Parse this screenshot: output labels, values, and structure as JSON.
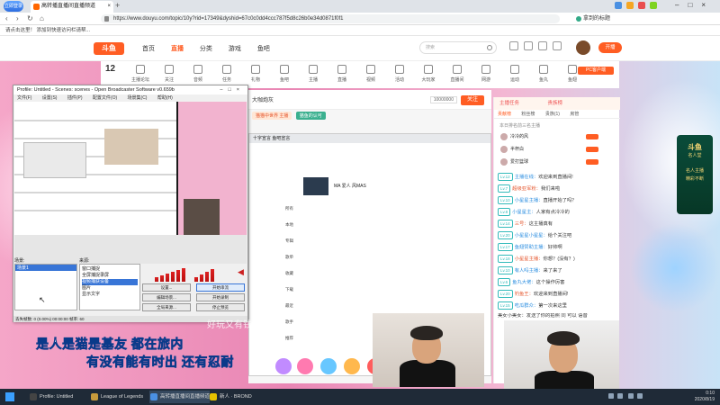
{
  "browser": {
    "badge": "立即登录",
    "tab_title": "高转播直播间直播频道",
    "url": "https://www.douyu.com/topic/10y?rid=17349&dyshid=67c0c0dd4ccc787f5d8c26b0e34d0871f0f1",
    "search_hint": "拿到的标题",
    "fav_text": "请点击这里！ 添加到快速访问栏请帮..."
  },
  "douyu": {
    "logo": "斗鱼",
    "nav": [
      "首页",
      "直播",
      "分类",
      "游戏",
      "鱼吧"
    ],
    "active_nav": "直播",
    "search_placeholder": "搜索",
    "kaibo": "开播",
    "follow_count": "12",
    "pc_btn": "PC客户端",
    "categories": [
      "主播论坛",
      "关注",
      "音频",
      "任务",
      "礼物",
      "鱼吧",
      "主播",
      "直播",
      "视频",
      "活动",
      "大玩家",
      "直播间",
      "网游",
      "运动",
      "鱼丸",
      "鱼翅",
      "更多"
    ]
  },
  "player": {
    "title": "大咖炮灰",
    "subtitle": "十字宣言 鱼吧宣言",
    "tags": [
      "猫猫中世界 主播",
      "猫鱼的认可"
    ],
    "view_count": "10000000",
    "follow": "关注",
    "cap_song": "MA 爱人 风MAS",
    "cap_rows": [
      "所有",
      "本地",
      "专辑",
      "歌单",
      "收藏",
      "下载",
      "最近",
      "歌手",
      "推荐"
    ]
  },
  "obs": {
    "title": "Profile: Untitled - Scenes: scenes - Open Broadcaster Software v0.659b",
    "menu": [
      "文件(F)",
      "设置(S)",
      "插件(P)",
      "配置文件(O)",
      "场景集(C)",
      "帮助(H)"
    ],
    "scenes_label": "场景:",
    "scene_selected": "场景1",
    "sources_label": "来源:",
    "sources": [
      "窗口捕捉",
      "全屏捕捉录屏",
      "视频捕获设备",
      "图片",
      "显示文字"
    ],
    "buttons": [
      "设置...",
      "开始串流",
      "编辑场景...",
      "开始录制",
      "全局来源...",
      "停止预览",
      "插件...",
      "退出"
    ],
    "status": "丢失帧数: 0 (0.00%)    00:00:00    帧率: 60"
  },
  "chat": {
    "head": "主播任务",
    "guard": "贵族榜",
    "tabs": [
      "贡献榜",
      "粉丝榜",
      "贵族(1)",
      "房管"
    ],
    "rank_title": "本日排名前三名主播",
    "ranks": [
      "冷冷的风",
      "半杯白",
      "爱打篮球"
    ],
    "messages": [
      {
        "lv": "Lv.12",
        "name": "主播在线：",
        "text": "欢迎来到直播间!"
      },
      {
        "lv": "Lv.7",
        "name": "超级亚军粉：",
        "text": "我们来啦"
      },
      {
        "lv": "Lv.10",
        "name": "小星星主播：",
        "text": "直播开始了吗？"
      },
      {
        "lv": "Lv.8",
        "name": "小星星主：",
        "text": "人家有点冷冷的"
      },
      {
        "lv": "Lv.14",
        "name": "三号：",
        "text": "这主播真有"
      },
      {
        "lv": "Lv.20",
        "name": "小星星小星星：",
        "text": "给个关注吧"
      },
      {
        "lv": "Lv.17",
        "name": "鱼翅赞助主播：",
        "text": "好帅啊"
      },
      {
        "lv": "Lv.18",
        "name": "小星星主播：",
        "text": "你想？(没有？)"
      },
      {
        "lv": "Lv.10",
        "name": "有人吗主播：",
        "text": "来了来了"
      },
      {
        "lv": "Lv.6",
        "name": "鱼丸大佬：",
        "text": "这个操作厉害"
      },
      {
        "lv": "Lv.20",
        "name": "钓鱼王：",
        "text": "欢迎来到直播间!"
      },
      {
        "lv": "Lv.15",
        "name": "吃瓜群众：",
        "text": "第一次来这里"
      }
    ],
    "footer_msg": "美女小美女：发送了你的拍照 同 可以 语音"
  },
  "overlay": {
    "line1": "是人是猫是基友 都在旅内",
    "line2": "有没有能有时出 还有忍耐",
    "ghost": "好玩又有钱吧"
  },
  "side_ad": {
    "title": "斗鱼",
    "line1": "名人堂",
    "line2": "名人主播",
    "line3": "精彩不断"
  },
  "taskbar": {
    "apps": [
      "Profile: Untitled",
      "League of Legends",
      "高转播直播间直播频道",
      "新人 · BROND"
    ],
    "time": "0:10",
    "date": "2020/8/19"
  },
  "colors": {
    "brand": "#ff5d23",
    "obs_select": "#3875d7",
    "taskbar": "#1f2a37"
  }
}
